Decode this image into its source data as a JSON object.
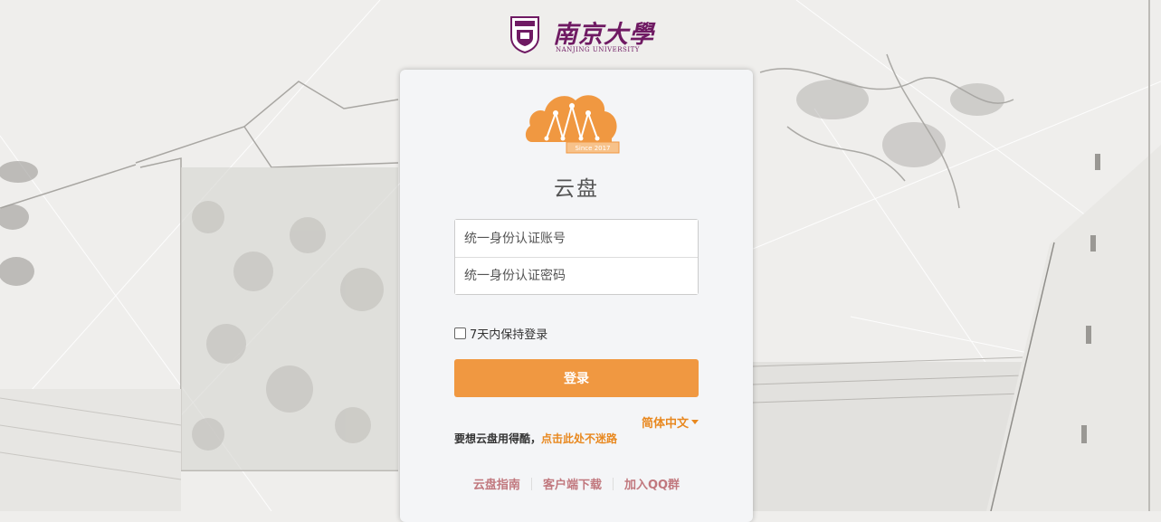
{
  "header": {
    "university_name_cn": "南京大學",
    "university_name_en": "NANJING UNIVERSITY"
  },
  "logo": {
    "badge_text": "Since 2017",
    "accent_color": "#f09841"
  },
  "card": {
    "title": "云盘"
  },
  "form": {
    "account_placeholder": "统一身份认证账号",
    "password_placeholder": "统一身份认证密码",
    "remember_label": "7天内保持登录",
    "remember_checked": false,
    "login_label": "登录"
  },
  "language": {
    "current": "简体中文"
  },
  "help": {
    "text": "要想云盘用得酷，",
    "link_label": "点击此处不迷路"
  },
  "footer": {
    "links": [
      "云盘指南",
      "客户端下载",
      "加入QQ群"
    ]
  },
  "colors": {
    "brand_orange": "#f09841",
    "link_orange": "#e8881f",
    "footer_link": "#c1787e",
    "nju_purple": "#6f1a63"
  }
}
